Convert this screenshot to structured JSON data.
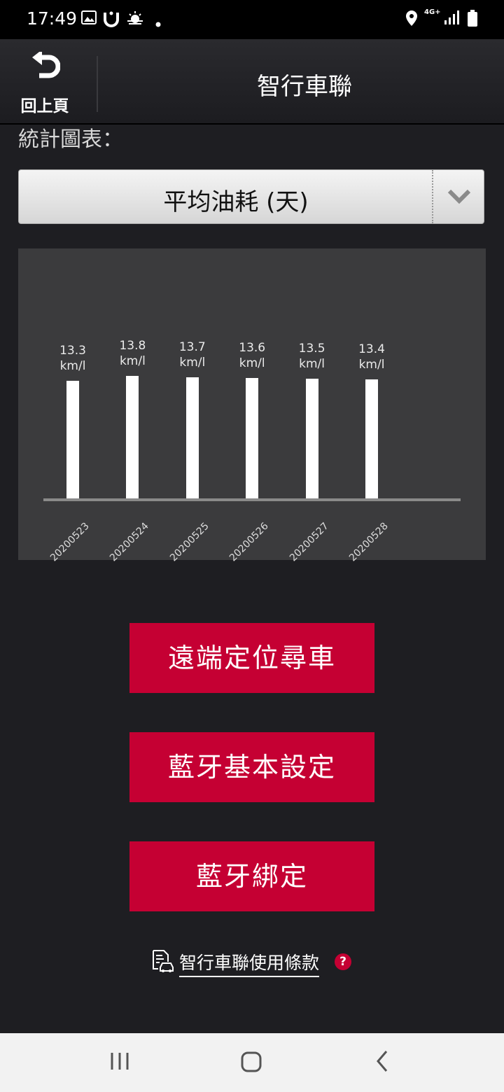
{
  "status_bar": {
    "time": "17:49",
    "network": "4G+"
  },
  "header": {
    "back_label": "回上頁",
    "title": "智行車聯"
  },
  "section": {
    "label": "統計圖表："
  },
  "dropdown": {
    "selected": "平均油耗 (天)"
  },
  "chart_data": {
    "type": "bar",
    "categories": [
      "20200523",
      "20200524",
      "20200525",
      "20200526",
      "20200527",
      "20200528"
    ],
    "values": [
      13.3,
      13.8,
      13.7,
      13.6,
      13.5,
      13.4
    ],
    "value_labels": [
      "13.3",
      "13.8",
      "13.7",
      "13.6",
      "13.5",
      "13.4"
    ],
    "unit": "km/l"
  },
  "buttons": {
    "locate": "遠端定位尋車",
    "bt_settings": "藍牙基本設定",
    "bt_binding": "藍牙綁定"
  },
  "terms": {
    "label": "智行車聯使用條款",
    "help": "?"
  },
  "colors": {
    "accent": "#c50033",
    "background": "#1e1e22",
    "chart_bg": "#3b3b3d"
  }
}
